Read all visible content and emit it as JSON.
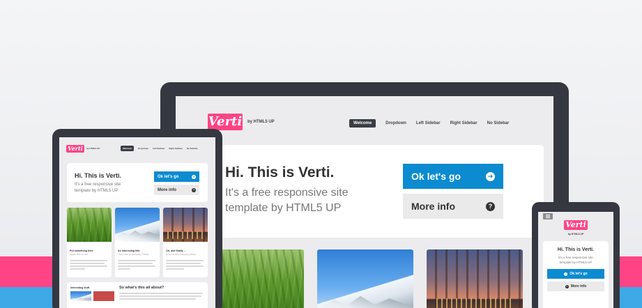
{
  "colors": {
    "brand_pink": "#ff4486",
    "accent_blue": "#0c8bd0",
    "stripe_blue": "#3fa8e6",
    "device_frame": "#353840"
  },
  "site": {
    "logo": "Verti",
    "tagline": "by HTML5 UP",
    "nav": [
      "Welcome",
      "Dropdown",
      "Left Sidebar",
      "Right Sidebar",
      "No Sidebar"
    ],
    "hero": {
      "title": "Hi. This is Verti.",
      "subtitle_line1": "It's a free responsive site",
      "subtitle_line2": "template by HTML5 UP",
      "primary_button": "Ok let's go",
      "secondary_button": "More info",
      "primary_icon": "arrow-right-circle-icon",
      "secondary_icon": "question-circle-icon"
    },
    "cards": [
      {
        "title": "Put something here",
        "subtitle": "Maybe here as well",
        "image": "wheat-field"
      },
      {
        "title": "An interesting title",
        "subtitle": "This is also an interesting subtitle",
        "image": "snowy-mountains"
      },
      {
        "title": "Oh, and finally ...",
        "subtitle": "Here's another intriguing subtitle",
        "image": "city-lights"
      }
    ],
    "section_interesting": "Interesting stuff",
    "section_about": "So what's this all about?"
  },
  "phone": {
    "menu_icon": "menu-icon"
  }
}
